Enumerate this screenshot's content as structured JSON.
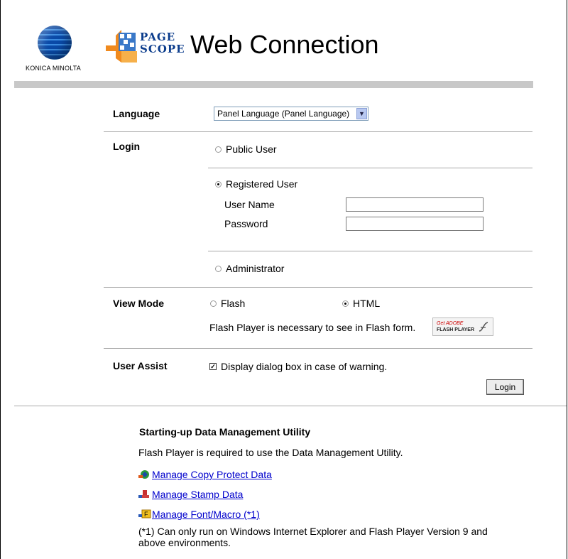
{
  "header": {
    "brand": "KONICA MINOLTA",
    "pagescope_line1": "PAGE",
    "pagescope_line2": "SCOPE",
    "title": "Web Connection"
  },
  "language": {
    "label": "Language",
    "selected": "Panel Language (Panel Language)"
  },
  "login": {
    "label": "Login",
    "public_user": "Public User",
    "registered_user": "Registered User",
    "user_name_label": "User Name",
    "password_label": "Password",
    "administrator": "Administrator",
    "selected": "Registered User"
  },
  "view_mode": {
    "label": "View Mode",
    "flash": "Flash",
    "html": "HTML",
    "selected": "HTML",
    "note": "Flash Player is necessary to see in Flash form.",
    "badge_get": "Get ADOBE",
    "badge_player": "FLASH PLAYER"
  },
  "user_assist": {
    "label": "User Assist",
    "checkbox_label": "Display dialog box in case of warning.",
    "checked": true
  },
  "login_button": "Login",
  "utility": {
    "heading": "Starting-up Data Management Utility",
    "description": "Flash Player is required to use the Data Management Utility.",
    "links": [
      {
        "label": "Manage Copy Protect Data",
        "icon": "copy-protect-icon"
      },
      {
        "label": "Manage Stamp Data",
        "icon": "stamp-icon"
      },
      {
        "label": "Manage Font/Macro (*1)",
        "icon": "font-macro-icon"
      }
    ],
    "footnote_line1": "(*1) Can only run on Windows Internet Explorer and Flash Player Version 9 and",
    "footnote_line2": "above environments."
  },
  "colors": {
    "link": "#0000cc",
    "brand_blue": "#0b3c8c",
    "top_bar": "#c8c8c8"
  }
}
